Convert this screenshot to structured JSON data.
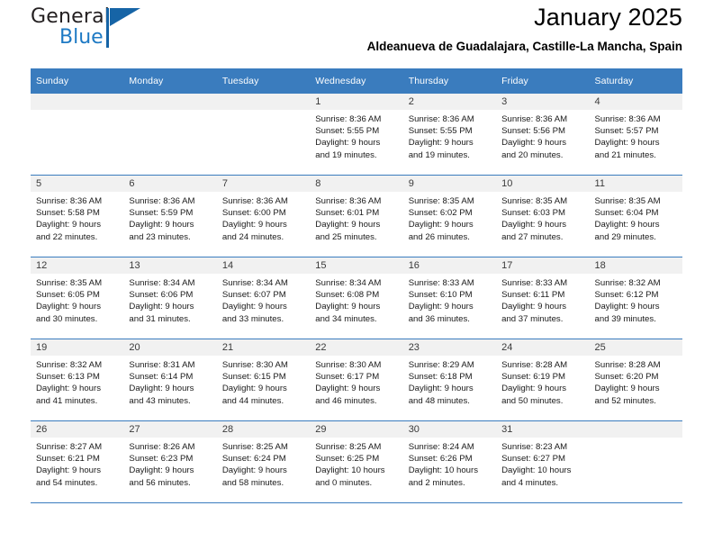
{
  "brand": {
    "name_part1": "General",
    "name_part2": "Blue",
    "logo_icon": "triangle-flag-icon"
  },
  "header": {
    "title": "January 2025",
    "subtitle": "Aldeanueva de Guadalajara, Castille-La Mancha, Spain"
  },
  "colors": {
    "header_blue": "#3a7cbe",
    "brand_blue": "#1e7ac4",
    "daynum_band": "#f1f1f1",
    "cell_border": "#c8c8c8"
  },
  "calendar": {
    "weekday_headers": [
      "Sunday",
      "Monday",
      "Tuesday",
      "Wednesday",
      "Thursday",
      "Friday",
      "Saturday"
    ],
    "weeks": [
      [
        {
          "day": "",
          "empty": true,
          "lines": []
        },
        {
          "day": "",
          "empty": true,
          "lines": []
        },
        {
          "day": "",
          "empty": true,
          "lines": []
        },
        {
          "day": "1",
          "lines": [
            "Sunrise: 8:36 AM",
            "Sunset: 5:55 PM",
            "Daylight: 9 hours",
            "and 19 minutes."
          ]
        },
        {
          "day": "2",
          "lines": [
            "Sunrise: 8:36 AM",
            "Sunset: 5:55 PM",
            "Daylight: 9 hours",
            "and 19 minutes."
          ]
        },
        {
          "day": "3",
          "lines": [
            "Sunrise: 8:36 AM",
            "Sunset: 5:56 PM",
            "Daylight: 9 hours",
            "and 20 minutes."
          ]
        },
        {
          "day": "4",
          "lines": [
            "Sunrise: 8:36 AM",
            "Sunset: 5:57 PM",
            "Daylight: 9 hours",
            "and 21 minutes."
          ]
        }
      ],
      [
        {
          "day": "5",
          "lines": [
            "Sunrise: 8:36 AM",
            "Sunset: 5:58 PM",
            "Daylight: 9 hours",
            "and 22 minutes."
          ]
        },
        {
          "day": "6",
          "lines": [
            "Sunrise: 8:36 AM",
            "Sunset: 5:59 PM",
            "Daylight: 9 hours",
            "and 23 minutes."
          ]
        },
        {
          "day": "7",
          "lines": [
            "Sunrise: 8:36 AM",
            "Sunset: 6:00 PM",
            "Daylight: 9 hours",
            "and 24 minutes."
          ]
        },
        {
          "day": "8",
          "lines": [
            "Sunrise: 8:36 AM",
            "Sunset: 6:01 PM",
            "Daylight: 9 hours",
            "and 25 minutes."
          ]
        },
        {
          "day": "9",
          "lines": [
            "Sunrise: 8:35 AM",
            "Sunset: 6:02 PM",
            "Daylight: 9 hours",
            "and 26 minutes."
          ]
        },
        {
          "day": "10",
          "lines": [
            "Sunrise: 8:35 AM",
            "Sunset: 6:03 PM",
            "Daylight: 9 hours",
            "and 27 minutes."
          ]
        },
        {
          "day": "11",
          "lines": [
            "Sunrise: 8:35 AM",
            "Sunset: 6:04 PM",
            "Daylight: 9 hours",
            "and 29 minutes."
          ]
        }
      ],
      [
        {
          "day": "12",
          "lines": [
            "Sunrise: 8:35 AM",
            "Sunset: 6:05 PM",
            "Daylight: 9 hours",
            "and 30 minutes."
          ]
        },
        {
          "day": "13",
          "lines": [
            "Sunrise: 8:34 AM",
            "Sunset: 6:06 PM",
            "Daylight: 9 hours",
            "and 31 minutes."
          ]
        },
        {
          "day": "14",
          "lines": [
            "Sunrise: 8:34 AM",
            "Sunset: 6:07 PM",
            "Daylight: 9 hours",
            "and 33 minutes."
          ]
        },
        {
          "day": "15",
          "lines": [
            "Sunrise: 8:34 AM",
            "Sunset: 6:08 PM",
            "Daylight: 9 hours",
            "and 34 minutes."
          ]
        },
        {
          "day": "16",
          "lines": [
            "Sunrise: 8:33 AM",
            "Sunset: 6:10 PM",
            "Daylight: 9 hours",
            "and 36 minutes."
          ]
        },
        {
          "day": "17",
          "lines": [
            "Sunrise: 8:33 AM",
            "Sunset: 6:11 PM",
            "Daylight: 9 hours",
            "and 37 minutes."
          ]
        },
        {
          "day": "18",
          "lines": [
            "Sunrise: 8:32 AM",
            "Sunset: 6:12 PM",
            "Daylight: 9 hours",
            "and 39 minutes."
          ]
        }
      ],
      [
        {
          "day": "19",
          "lines": [
            "Sunrise: 8:32 AM",
            "Sunset: 6:13 PM",
            "Daylight: 9 hours",
            "and 41 minutes."
          ]
        },
        {
          "day": "20",
          "lines": [
            "Sunrise: 8:31 AM",
            "Sunset: 6:14 PM",
            "Daylight: 9 hours",
            "and 43 minutes."
          ]
        },
        {
          "day": "21",
          "lines": [
            "Sunrise: 8:30 AM",
            "Sunset: 6:15 PM",
            "Daylight: 9 hours",
            "and 44 minutes."
          ]
        },
        {
          "day": "22",
          "lines": [
            "Sunrise: 8:30 AM",
            "Sunset: 6:17 PM",
            "Daylight: 9 hours",
            "and 46 minutes."
          ]
        },
        {
          "day": "23",
          "lines": [
            "Sunrise: 8:29 AM",
            "Sunset: 6:18 PM",
            "Daylight: 9 hours",
            "and 48 minutes."
          ]
        },
        {
          "day": "24",
          "lines": [
            "Sunrise: 8:28 AM",
            "Sunset: 6:19 PM",
            "Daylight: 9 hours",
            "and 50 minutes."
          ]
        },
        {
          "day": "25",
          "lines": [
            "Sunrise: 8:28 AM",
            "Sunset: 6:20 PM",
            "Daylight: 9 hours",
            "and 52 minutes."
          ]
        }
      ],
      [
        {
          "day": "26",
          "lines": [
            "Sunrise: 8:27 AM",
            "Sunset: 6:21 PM",
            "Daylight: 9 hours",
            "and 54 minutes."
          ]
        },
        {
          "day": "27",
          "lines": [
            "Sunrise: 8:26 AM",
            "Sunset: 6:23 PM",
            "Daylight: 9 hours",
            "and 56 minutes."
          ]
        },
        {
          "day": "28",
          "lines": [
            "Sunrise: 8:25 AM",
            "Sunset: 6:24 PM",
            "Daylight: 9 hours",
            "and 58 minutes."
          ]
        },
        {
          "day": "29",
          "lines": [
            "Sunrise: 8:25 AM",
            "Sunset: 6:25 PM",
            "Daylight: 10 hours",
            "and 0 minutes."
          ]
        },
        {
          "day": "30",
          "lines": [
            "Sunrise: 8:24 AM",
            "Sunset: 6:26 PM",
            "Daylight: 10 hours",
            "and 2 minutes."
          ]
        },
        {
          "day": "31",
          "lines": [
            "Sunrise: 8:23 AM",
            "Sunset: 6:27 PM",
            "Daylight: 10 hours",
            "and 4 minutes."
          ]
        },
        {
          "day": "",
          "empty": true,
          "lines": []
        }
      ]
    ]
  }
}
